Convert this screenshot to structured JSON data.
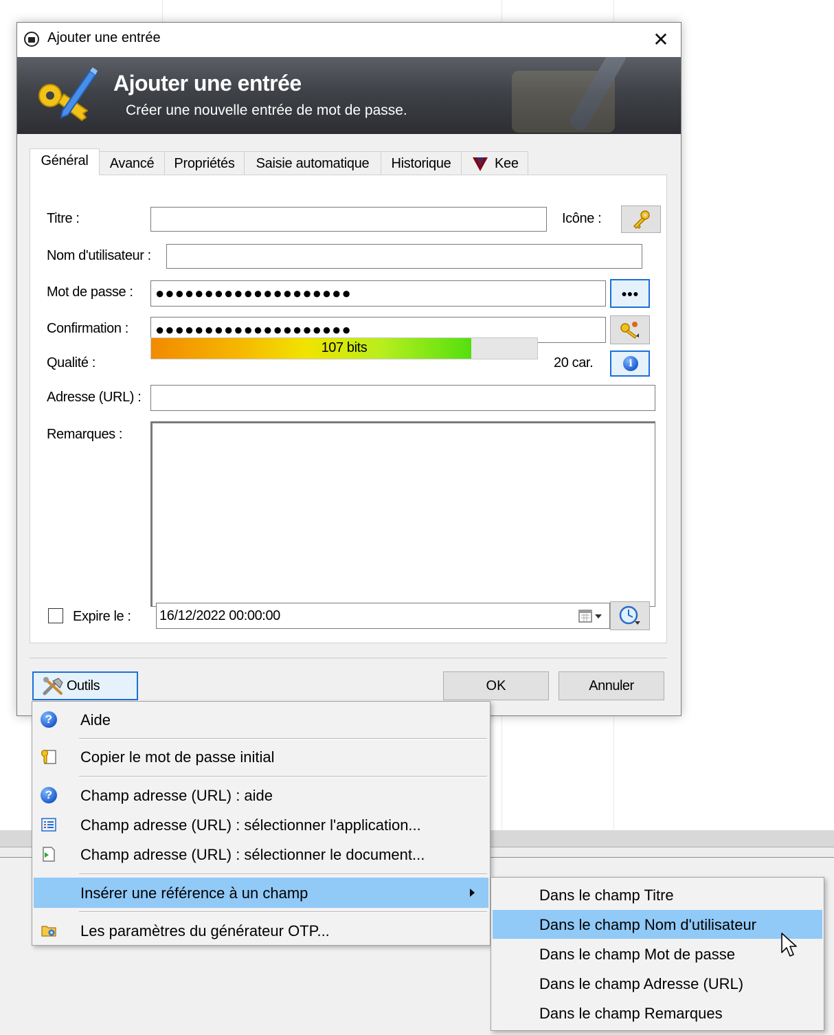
{
  "window": {
    "title": "Ajouter une entrée",
    "close_label": "✕"
  },
  "banner": {
    "title": "Ajouter une entrée",
    "subtitle": "Créer une nouvelle entrée de mot de passe."
  },
  "tabs": [
    {
      "label": "Général",
      "active": true
    },
    {
      "label": "Avancé"
    },
    {
      "label": "Propriétés"
    },
    {
      "label": "Saisie automatique"
    },
    {
      "label": "Historique"
    },
    {
      "label": "Kee"
    }
  ],
  "form": {
    "title_label": "Titre :",
    "title_value": "",
    "icon_label": "Icône :",
    "username_label": "Nom d'utilisateur :",
    "username_value": "",
    "password_label": "Mot de passe :",
    "password_mask": "●●●●●●●●●●●●●●●●●●●●",
    "confirm_label": "Confirmation :",
    "confirm_mask": "●●●●●●●●●●●●●●●●●●●●",
    "show_password_label": "●●●",
    "quality_label": "Qualité :",
    "quality_text": "107 bits",
    "quality_fraction": 0.83,
    "char_count": "20 car.",
    "url_label": "Adresse (URL) :",
    "url_value": "",
    "notes_label": "Remarques :",
    "notes_value": "",
    "expires_label": "Expire le :",
    "expires_checked": false,
    "expires_value": "16/12/2022 00:00:00"
  },
  "buttons": {
    "tools": "Outils",
    "ok": "OK",
    "cancel": "Annuler"
  },
  "tools_menu": [
    {
      "label": "Aide",
      "icon": "help-icon"
    },
    {
      "label": "Copier le mot de passe initial",
      "icon": "copy-key-icon"
    },
    {
      "label": "Champ adresse (URL) : aide",
      "icon": "help-icon"
    },
    {
      "label": "Champ adresse (URL) : sélectionner l'application...",
      "icon": "app-list-icon"
    },
    {
      "label": "Champ adresse (URL) : sélectionner le document...",
      "icon": "document-icon"
    },
    {
      "label": "Insérer une référence à un champ",
      "icon": "",
      "highlighted": true,
      "has_submenu": true
    },
    {
      "label": "Les paramètres du générateur OTP...",
      "icon": "otp-settings-icon"
    }
  ],
  "submenu": [
    {
      "label": "Dans le champ Titre"
    },
    {
      "label": "Dans le champ Nom d'utilisateur",
      "highlighted": true
    },
    {
      "label": "Dans le champ Mot de passe"
    },
    {
      "label": "Dans le champ Adresse (URL)"
    },
    {
      "label": "Dans le champ Remarques"
    }
  ],
  "colors": {
    "menu_highlight": "#91c9f7",
    "banner_dark": "#2c2e33",
    "focus_blue": "#1c6fd8"
  }
}
